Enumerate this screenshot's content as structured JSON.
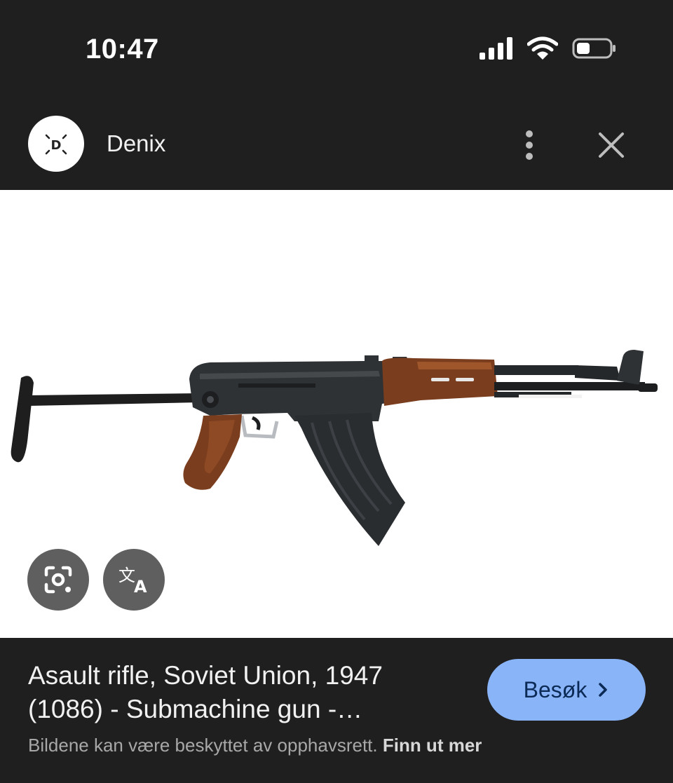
{
  "status_bar": {
    "time": "10:47",
    "icons": [
      "signal-icon",
      "wifi-icon",
      "battery-icon"
    ]
  },
  "header": {
    "site_name": "Denix",
    "avatar_letter": "D",
    "icons": [
      "more-vert-icon",
      "close-icon"
    ]
  },
  "image": {
    "subject": "assault-rifle-with-folding-stock",
    "actions": [
      "google-lens-icon",
      "translate-icon"
    ]
  },
  "result": {
    "title": "Asault rifle, Soviet Union, 1947 (1086) - Submachine gun -…",
    "visit_label": "Besøk",
    "copyright_text": "Bildene kan være beskyttet av opphavsrett.",
    "learn_more": "Finn ut mer"
  },
  "colors": {
    "background": "#1f1f1f",
    "button_accent": "#8ab4f8",
    "muted_text": "#a8a8a8"
  }
}
